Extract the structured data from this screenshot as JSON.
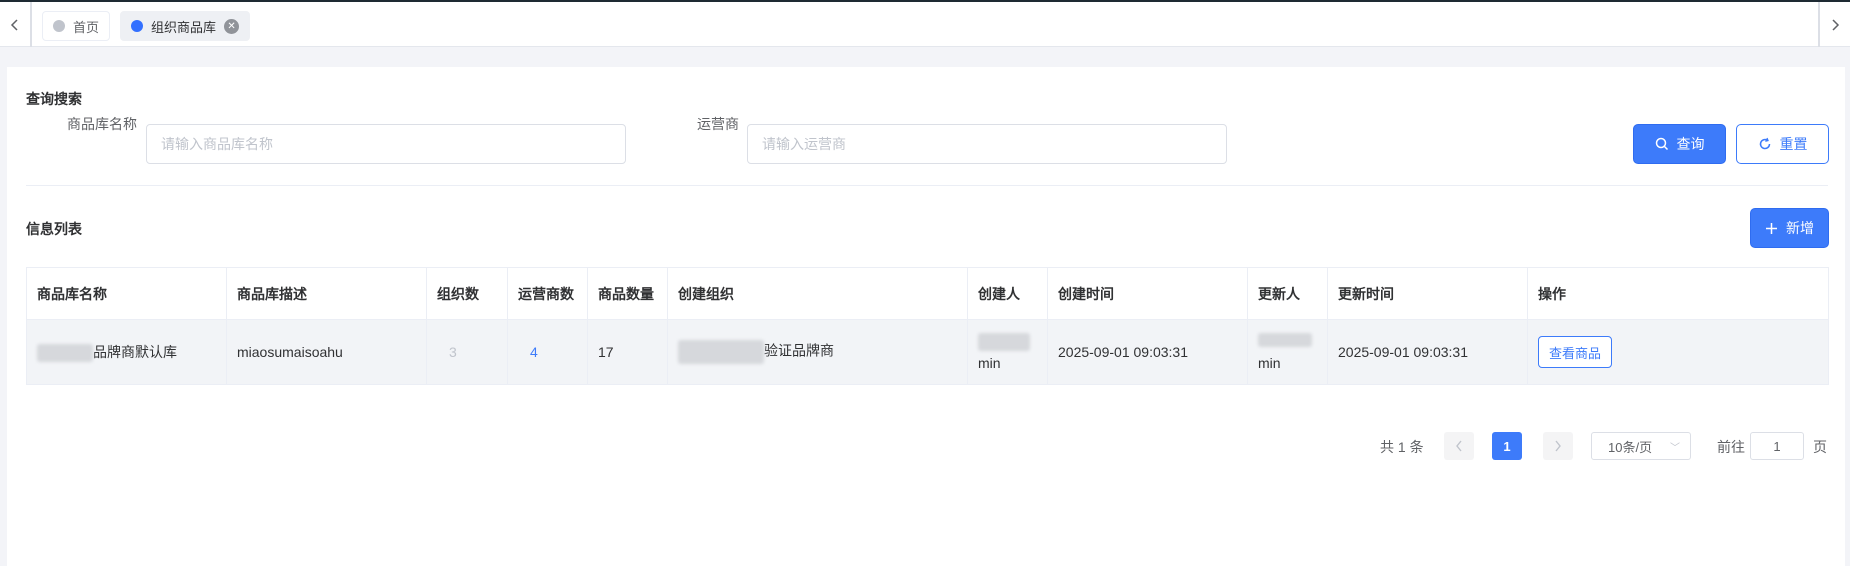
{
  "tabs": [
    {
      "label": "首页",
      "active": false
    },
    {
      "label": "组织商品库",
      "active": true
    }
  ],
  "search": {
    "title": "查询搜索",
    "name_label": "商品库名称",
    "name_placeholder": "请输入商品库名称",
    "operator_label": "运营商",
    "operator_placeholder": "请输入运营商",
    "query_button": "查询",
    "reset_button": "重置"
  },
  "list": {
    "title": "信息列表",
    "add_button": "新增",
    "columns": [
      "商品库名称",
      "商品库描述",
      "组织数",
      "运营商数",
      "商品数量",
      "创建组织",
      "创建人",
      "创建时间",
      "更新人",
      "更新时间",
      "操作"
    ],
    "rows": [
      {
        "name_suffix": "品牌商默认库",
        "description": "miaosumaisoahu",
        "org_count": "3",
        "operator_count": "4",
        "product_count": "17",
        "creator_org_suffix": "验证品牌商",
        "creator": "min",
        "created_at": "2025-09-01 09:03:31",
        "updater": "min",
        "updated_at": "2025-09-01 09:03:31",
        "action": "查看商品"
      }
    ]
  },
  "pagination": {
    "total": "共 1 条",
    "current_page": "1",
    "page_size": "10条/页",
    "goto_label": "前往",
    "goto_value": "1",
    "page_unit": "页"
  },
  "colors": {
    "primary": "#3d7bfa",
    "row_background": "#f2f4f7",
    "page_background": "#f3f4f8"
  },
  "icons": [
    "chevron-left-icon",
    "chevron-right-icon",
    "close-icon",
    "search-icon",
    "refresh-icon",
    "plus-icon",
    "chevron-down-icon"
  ]
}
